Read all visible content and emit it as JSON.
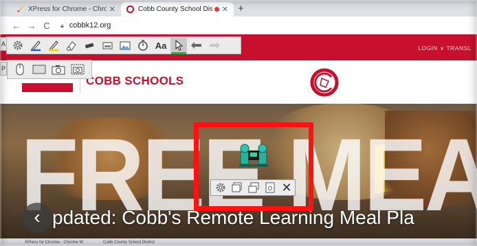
{
  "browser": {
    "tabs": [
      {
        "title": "XPress for Chrome - Chrome W",
        "close": "✕"
      },
      {
        "title": "Cobb County School District",
        "close": "✕"
      }
    ],
    "new_tab": "+",
    "url": "cobbk12.org"
  },
  "site": {
    "header_links": "LOGIN ∨   TRANSL",
    "name": "COBB SCHOOLS",
    "hero_word": "FREE MEA",
    "headline": "pdated: Cobb's Remote Learning Meal Pla",
    "prev_label": "‹",
    "colors": {
      "brand_red": "#c8102e",
      "accent_yellow": "#e8c63a"
    }
  },
  "xpress": {
    "row_labels": [
      "A",
      "P"
    ],
    "text_tool": "Aa",
    "toolbar_icons": [
      "gear-icon",
      "pen-blue-icon",
      "highlighter-icon",
      "eraser-icon",
      "marker-icon",
      "stamp-icon",
      "image-icon",
      "timer-icon",
      "text-icon",
      "pointer-icon",
      "undo-icon",
      "redo-icon"
    ],
    "second_row_icons": [
      "mouse-icon",
      "whiteboard-icon",
      "camera-icon",
      "screenshot-icon"
    ],
    "capture_tool_icons": [
      "gear-icon",
      "window-icon",
      "window-copy-icon",
      "save-icon",
      "close-icon"
    ],
    "capture_close": "✕",
    "selected_tool": "pointer-icon",
    "capture_border_color": "#ff1111"
  },
  "thumbnail_strip": {
    "tabs": [
      "XPress for Chrome - Chrome W",
      "Cobb County School District"
    ]
  }
}
